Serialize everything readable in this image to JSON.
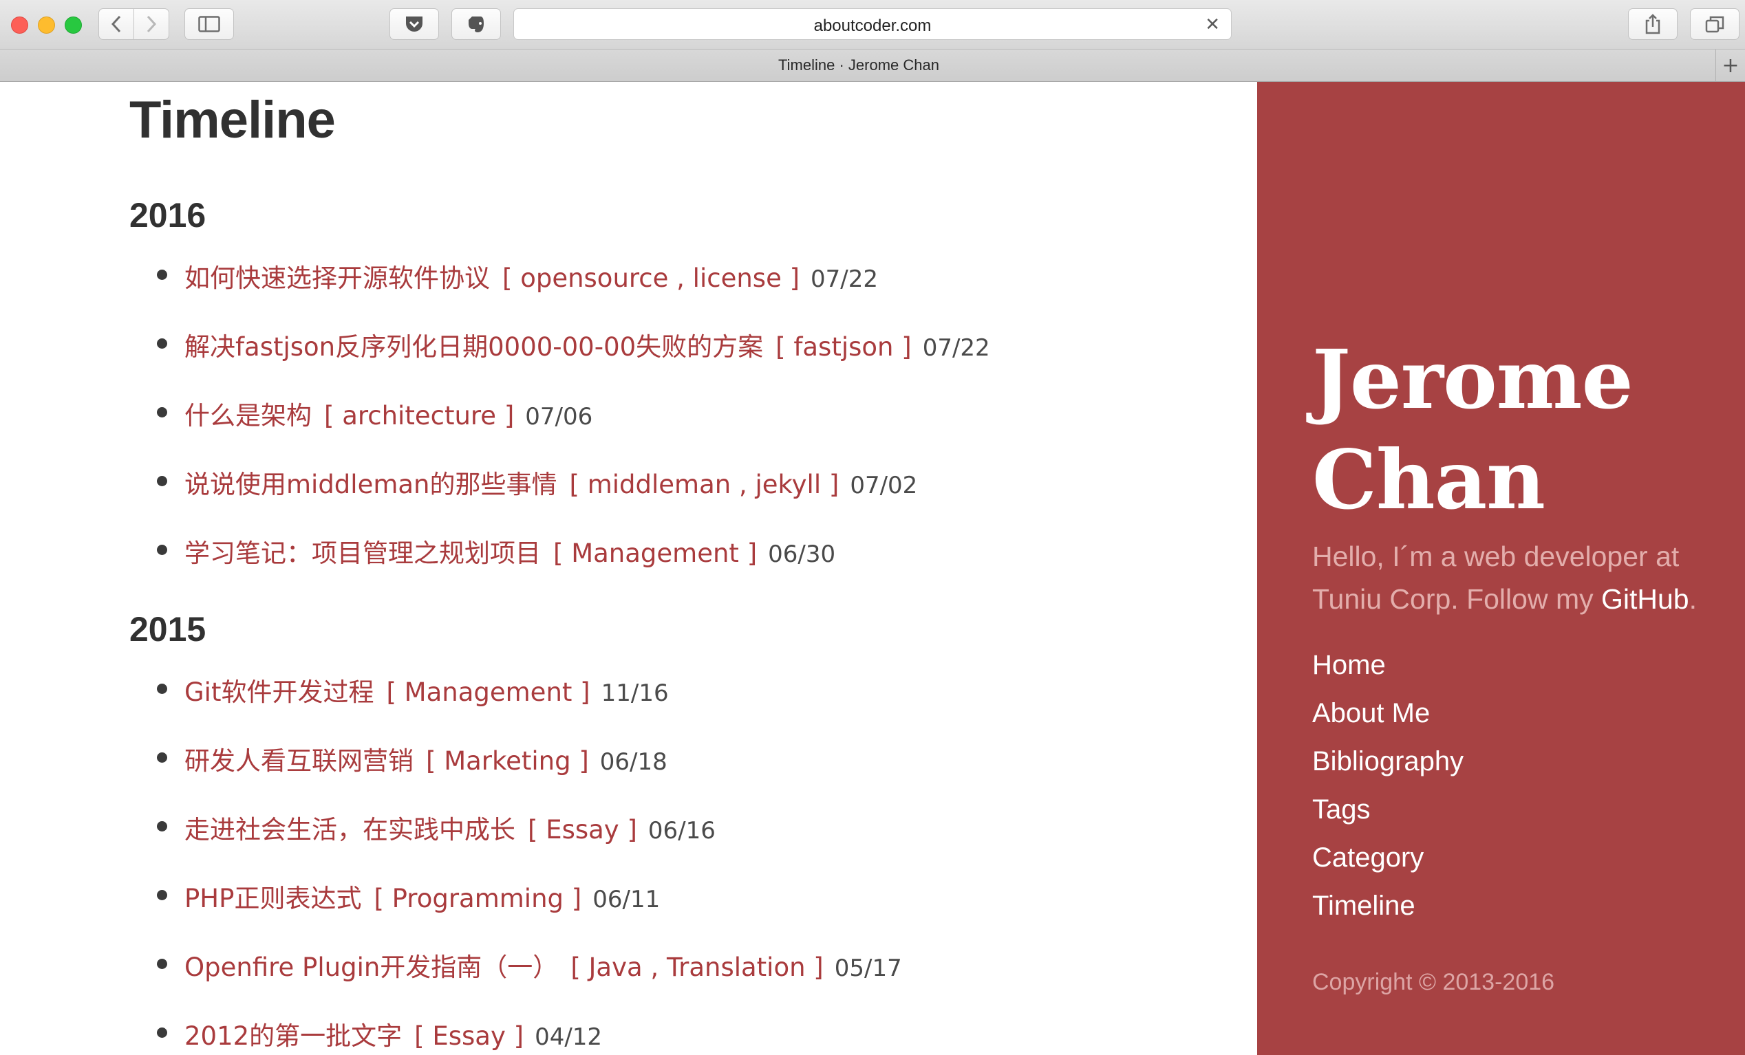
{
  "browser": {
    "address": "aboutcoder.com",
    "tab_title": "Timeline · Jerome Chan",
    "icons": [
      "back-icon",
      "forward-icon",
      "sidebar-toggle-icon",
      "pocket-icon",
      "evernote-icon",
      "clear-icon",
      "share-icon",
      "tabs-overview-icon",
      "new-tab-icon"
    ]
  },
  "page": {
    "title": "Timeline",
    "years": [
      {
        "year": "2016",
        "posts": [
          {
            "title": "如何快速选择开源软件协议",
            "tags": "[ opensource , license ]",
            "date": "07/22"
          },
          {
            "title": "解决fastjson反序列化日期0000-00-00失败的方案",
            "tags": "[ fastjson ]",
            "date": "07/22"
          },
          {
            "title": "什么是架构",
            "tags": "[ architecture ]",
            "date": "07/06"
          },
          {
            "title": "说说使用middleman的那些事情",
            "tags": "[ middleman , jekyll ]",
            "date": "07/02"
          },
          {
            "title": "学习笔记：项目管理之规划项目",
            "tags": "[ Management ]",
            "date": "06/30"
          }
        ]
      },
      {
        "year": "2015",
        "posts": [
          {
            "title": "Git软件开发过程",
            "tags": "[ Management ]",
            "date": "11/16"
          },
          {
            "title": "研发人看互联网营销",
            "tags": "[ Marketing ]",
            "date": "06/18"
          },
          {
            "title": "走进社会生活，在实践中成长",
            "tags": "[ Essay ]",
            "date": "06/16"
          },
          {
            "title": "PHP正则表达式",
            "tags": "[ Programming ]",
            "date": "06/11"
          },
          {
            "title": "Openfire Plugin开发指南（一）",
            "tags": "[ Java , Translation ]",
            "date": "05/17"
          },
          {
            "title": "2012的第一批文字",
            "tags": "[ Essay ]",
            "date": "04/12"
          }
        ]
      }
    ]
  },
  "sidebar": {
    "name_line1": "Jerome",
    "name_line2": "Chan",
    "lead_text": "Hello, I´m a web developer at Tuniu Corp. Follow my ",
    "lead_link": "GitHub",
    "lead_end": ".",
    "nav": [
      "Home",
      "About Me",
      "Bibliography",
      "Tags",
      "Category",
      "Timeline"
    ],
    "copyright": "Copyright © 2013-2016",
    "colors": {
      "background": "#a74243",
      "link": "#a93b3d"
    }
  }
}
